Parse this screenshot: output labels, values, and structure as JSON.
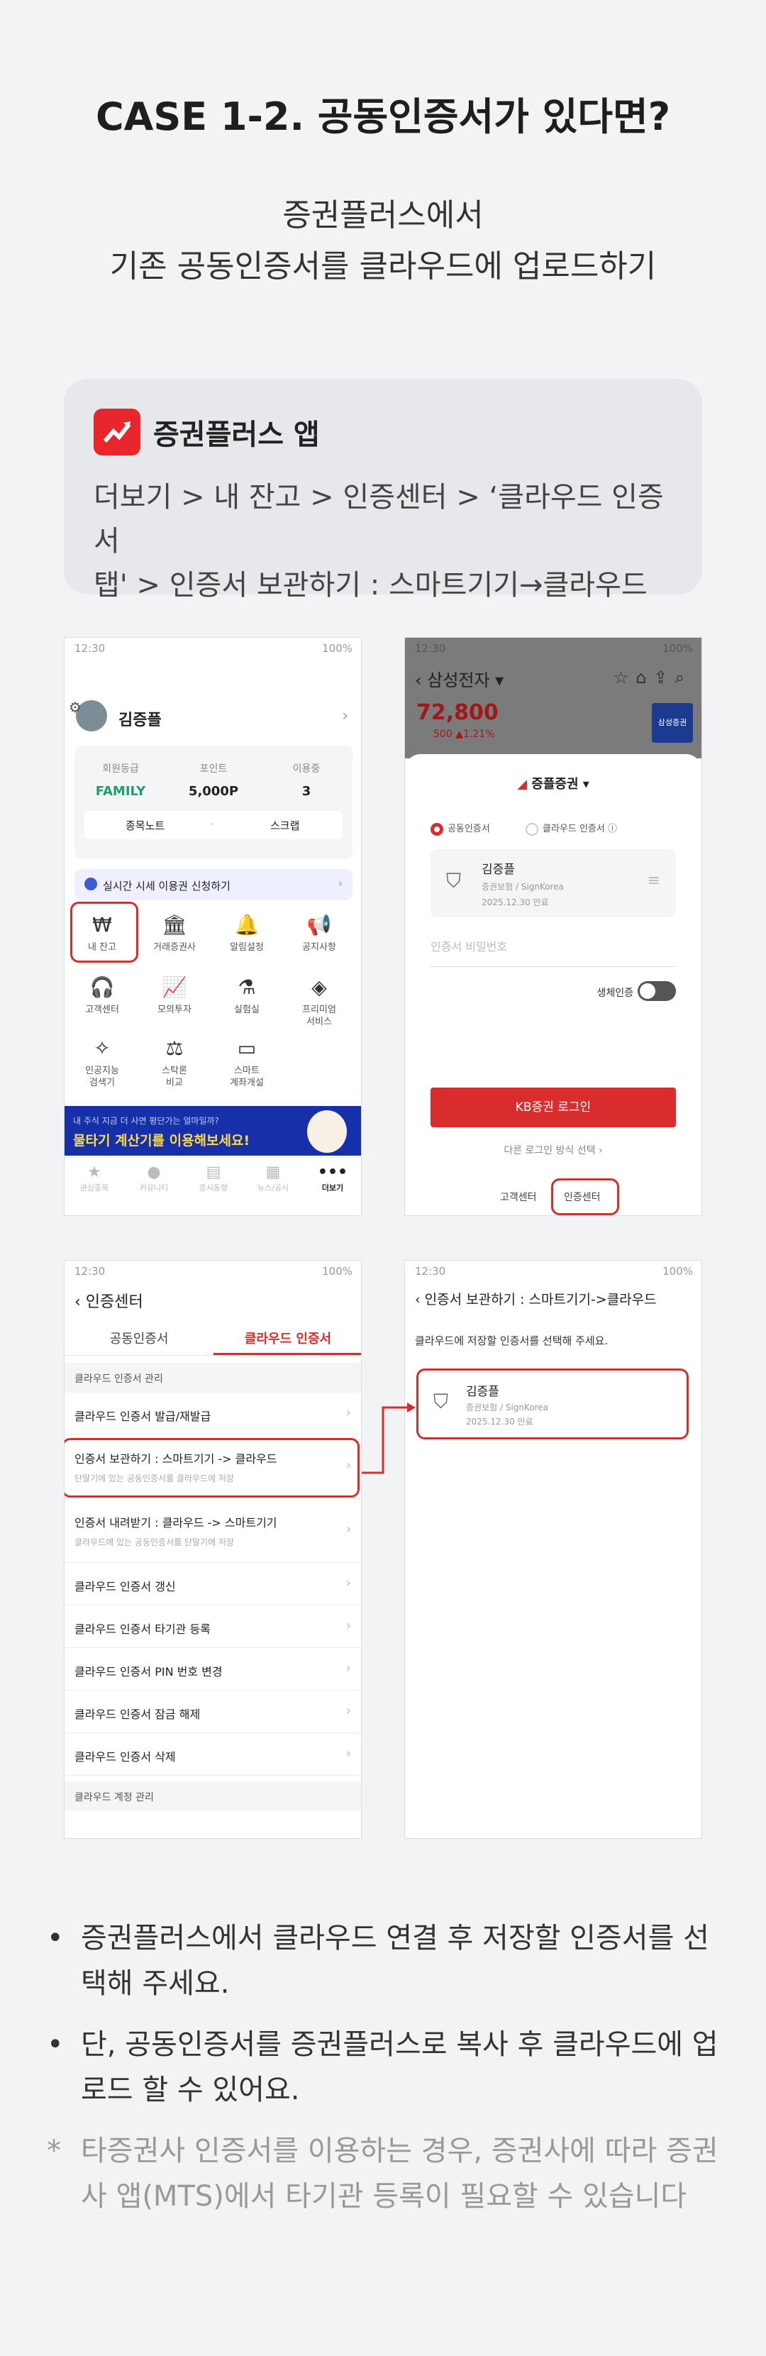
{
  "header": {
    "case_title": "CASE 1-2. 공동인증서가 있다면?",
    "subtitle_line1": "증권플러스에서",
    "subtitle_line2": "기존 공동인증서를 클라우드에 업로드하기"
  },
  "info_card": {
    "app_name": "증권플러스 앱",
    "path_line1": "더보기 > 내 잔고 > 인증센터 > ‘클라우드 인증서",
    "path_line2": "탭' > 인증서 보관하기 : 스마트기기→클라우드"
  },
  "status": {
    "time": "12:30",
    "battery": "100%"
  },
  "phone1": {
    "user_name": "김증플",
    "stats": [
      {
        "label": "회원등급",
        "value": "FAMILY"
      },
      {
        "label": "포인트",
        "value": "5,000P"
      },
      {
        "label": "이용중",
        "value": "3"
      }
    ],
    "btn_left": "종목노트",
    "btn_sep": "·",
    "btn_right": "스크랩",
    "banner": "실시간 시세 이용권 신청하기",
    "grid": [
      {
        "icon": "won-icon",
        "glyph": "₩",
        "label": "내 잔고"
      },
      {
        "icon": "bank-icon",
        "glyph": "🏛",
        "label": "거래증권사"
      },
      {
        "icon": "bell-icon",
        "glyph": "🔔",
        "label": "알림설정"
      },
      {
        "icon": "megaphone-icon",
        "glyph": "📢",
        "label": "공지사항"
      },
      {
        "icon": "headset-icon",
        "glyph": "🎧",
        "label": "고객센터"
      },
      {
        "icon": "chart-icon",
        "glyph": "📈",
        "label": "모의투자"
      },
      {
        "icon": "flask-icon",
        "glyph": "⚗",
        "label": "실험실"
      },
      {
        "icon": "premium-icon",
        "glyph": "◈",
        "label": "프리미엄\n서비스"
      },
      {
        "icon": "ai-icon",
        "glyph": "✧",
        "label": "인공지능\n검색기"
      },
      {
        "icon": "compare-icon",
        "glyph": "⚖",
        "label": "스탁론\n비교"
      },
      {
        "icon": "account-icon",
        "glyph": "▭",
        "label": "스마트\n계좌개설"
      }
    ],
    "ad_small": "내 주식 지금 더 사면 평단가는 얼마일까?",
    "ad_big": "물타기 계산기를 이용해보세요!",
    "tabs": [
      {
        "label": "관심종목",
        "glyph": "★"
      },
      {
        "label": "커뮤니티",
        "glyph": "●"
      },
      {
        "label": "증시동향",
        "glyph": "▤"
      },
      {
        "label": "뉴스/공시",
        "glyph": "▦"
      },
      {
        "label": "더보기",
        "glyph": "•••"
      }
    ]
  },
  "phone2": {
    "stock_name": "삼성전자 ▾",
    "price": "72,800",
    "change": "500 ▲1.21%",
    "badge": "삼성증권",
    "brand": "증플증권 ▾",
    "radio_1": "공동인증서",
    "radio_2": "클라우드 인증서 ⓘ",
    "cert_name": "김증플",
    "cert_issuer": "증권보험 / SignKorea",
    "cert_expiry": "2025.12.30 만료",
    "password_placeholder": "인증서 비밀번호",
    "bio_label": "생체인증",
    "login_button": "KB증권 로그인",
    "other_login": "다른 로그인 방식 선택 ›",
    "footer_left": "고객센터",
    "footer_right": "인증센터"
  },
  "phone3": {
    "title": "인증센터",
    "tab_1": "공동인증서",
    "tab_2": "클라우드 인증서",
    "section_1": "클라우드 인증서 관리",
    "section_2": "클라우드 계정 관리",
    "rows": [
      {
        "title": "클라우드 인증서 발급/재발급",
        "sub": ""
      },
      {
        "title": "인증서 보관하기 : 스마트기기 -> 클라우드",
        "sub": "단말기에 있는 공동인증서를 클라우드에 저장"
      },
      {
        "title": "인증서 내려받기 : 클라우드 -> 스마트기기",
        "sub": "클라우드에 있는 공동인증서를 단말기에 저장"
      },
      {
        "title": "클라우드 인증서 갱신",
        "sub": ""
      },
      {
        "title": "클라우드 인증서 타기관 등록",
        "sub": ""
      },
      {
        "title": "클라우드 인증서 PIN 번호 변경",
        "sub": ""
      },
      {
        "title": "클라우드 인증서 잠금 해제",
        "sub": ""
      },
      {
        "title": "클라우드 인증서 삭제",
        "sub": ""
      }
    ]
  },
  "phone4": {
    "title": "인증서 보관하기 : 스마트기기->클라우드",
    "desc": "클라우드에 저장할 인증서를 선택해 주세요.",
    "cert_name": "김증플",
    "cert_issuer": "증권보험 / SignKorea",
    "cert_expiry": "2025.12.30 만료"
  },
  "bullets": {
    "b1": "증권플러스에서 클라우드 연결 후 저장할 인증서를 선택해 주세요.",
    "b2": "단, 공동인증서를 증권플러스로 복사 후 클라우드에 업로드 할 수 있어요.",
    "note": "타증권사 인증서를 이용하는 경우, 증권사에 따라 증권사 앱(MTS)에서 타기관 등록이 필요할 수 있습니다",
    "dot": "•",
    "star": "*"
  },
  "colors": {
    "accent": "#d92c2c",
    "green": "#1e9e6b",
    "navy": "#1530a8"
  }
}
